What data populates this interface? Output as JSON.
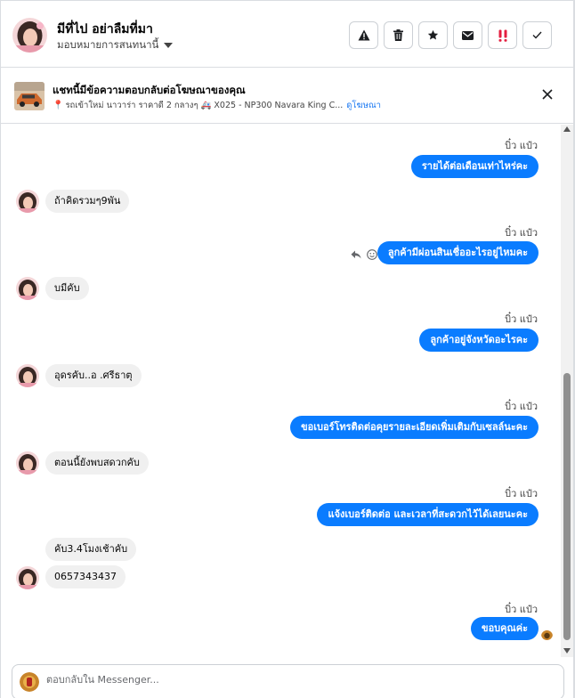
{
  "header": {
    "contact_name": "มีที่ไป อย่าลืมที่มา",
    "assign_label": "มอบหมายการสนทนานี้",
    "actions": [
      {
        "name": "report-spam-button",
        "icon": "warning-icon"
      },
      {
        "name": "delete-button",
        "icon": "trash-icon"
      },
      {
        "name": "star-button",
        "icon": "star-icon"
      },
      {
        "name": "mark-unread-button",
        "icon": "envelope-icon"
      },
      {
        "name": "follow-up-button",
        "icon": "double-exclamation-icon"
      },
      {
        "name": "mark-done-button",
        "icon": "check-icon"
      }
    ]
  },
  "ad": {
    "title": "แชทนี้มีข้อความตอบกลับต่อโฆษณาของคุณ",
    "subtitle": "รถเข้าใหม่ นาวาร่า ราคาดี 2 กลางๆ 🚑 X025 - NP300 Navara King C...",
    "link": "ดูโฆษณา",
    "pin_icon": "📍"
  },
  "messages": {
    "outgoing_sender": "บิ๋ว แป๋ว",
    "items": [
      {
        "dir": "out",
        "text": "รายได้ต่อเดือนเท่าไหร่คะ"
      },
      {
        "dir": "in",
        "text": "ถ้าคิดรวมๆ9พัน"
      },
      {
        "dir": "out",
        "text": "ลูกค้ามีผ่อนสินเชื่ออะไรอยู่ไหมคะ"
      },
      {
        "dir": "in",
        "text": "บมีคับ"
      },
      {
        "dir": "out",
        "text": "ลูกค้าอยู่จังหวัดอะไรคะ"
      },
      {
        "dir": "in",
        "text": "อุดรคับ..อ .ศรีธาตุ"
      },
      {
        "dir": "out",
        "text": "ขอเบอร์โทรติดต่อคุยรายละเอียดเพิ่มเติมกับเซลล์นะคะ"
      },
      {
        "dir": "in",
        "text": "ตอนนี้ยังพบสดวกคับ"
      },
      {
        "dir": "out",
        "text": "แจ้งเบอร์ติดต่อ  และเวลาที่สะดวกไว้ได้เลยนะคะ"
      },
      {
        "dir": "in",
        "text": "คับ3.4โมงเช้าคับ"
      },
      {
        "dir": "in",
        "text": "0657343437"
      },
      {
        "dir": "out",
        "text": "ขอบคุณค่ะ"
      }
    ]
  },
  "composer": {
    "placeholder": "ตอบกลับใน Messenger..."
  },
  "colors": {
    "accent": "#0a7cff",
    "incoming_bubble": "#f0f0f0",
    "border": "#dadde1"
  }
}
